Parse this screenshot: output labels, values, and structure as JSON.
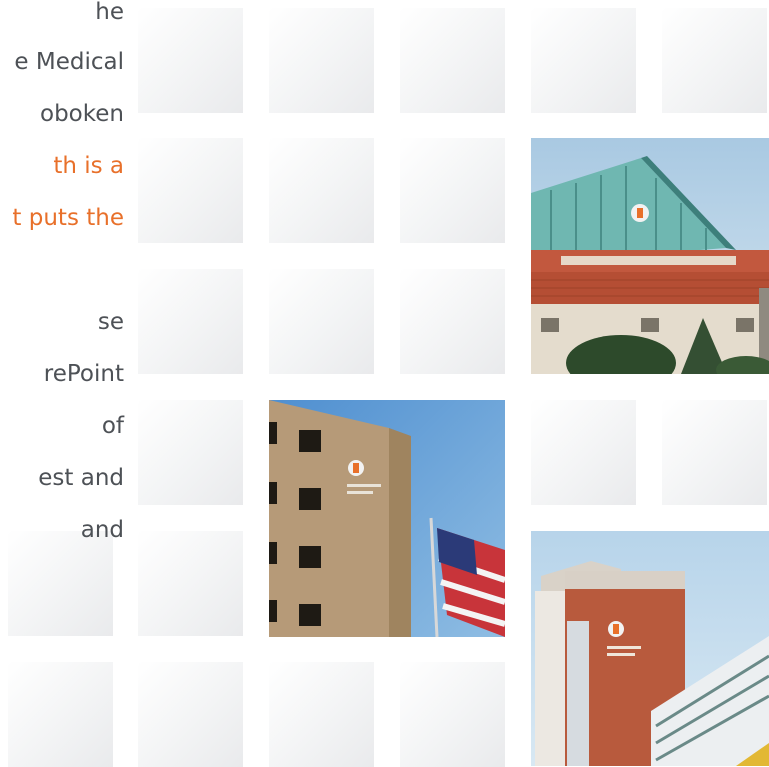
{
  "text_lines": {
    "l1": "he",
    "l2": "e Medical",
    "l3": "oboken",
    "l4": "th is a",
    "l5": "t puts the",
    "l6": "se",
    "l7": "rePoint",
    "l8": "of",
    "l9": "est and",
    "l10": "and"
  },
  "colors": {
    "body_text": "#4d5156",
    "highlight_text": "#e8702a",
    "tile": "#eeeff1"
  }
}
